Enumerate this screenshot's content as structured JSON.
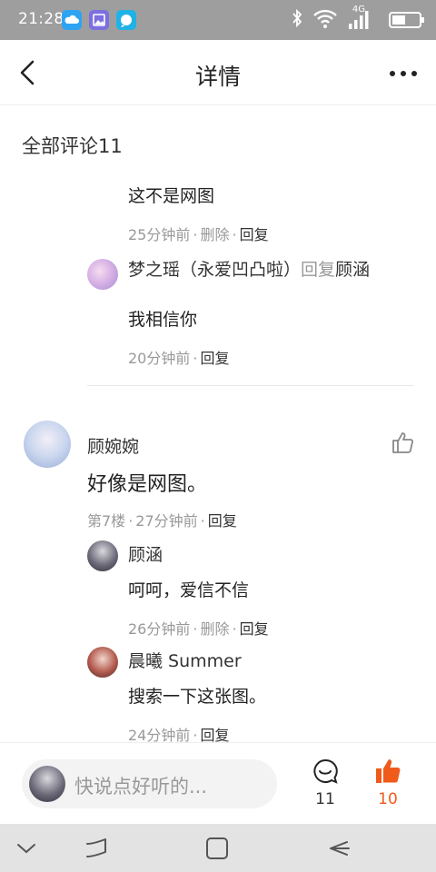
{
  "status_bar": {
    "time": "21:28",
    "network": "4G",
    "app_icons": [
      "cloud-app-icon",
      "gallery-app-icon",
      "chat-app-icon"
    ]
  },
  "header": {
    "title": "详情",
    "back_icon": "chevron-left-icon",
    "more_icon": "more-dots-icon"
  },
  "section": {
    "heading": "全部评论11"
  },
  "partial_thread": {
    "first_reply": {
      "text": "这不是网图",
      "time": "25分钟前",
      "actions": [
        "删除",
        "回复"
      ]
    },
    "second_reply": {
      "author": "梦之瑶（永爱凹凸啦）",
      "reply_word": "回复",
      "reply_to": "顾涵",
      "text": "我相信你",
      "time": "20分钟前",
      "actions": [
        "回复"
      ]
    }
  },
  "comment": {
    "author": "顾婉婉",
    "text": "好像是网图。",
    "floor": "第7楼",
    "time": "27分钟前",
    "action": "回复",
    "replies": [
      {
        "author": "顾涵",
        "text": "呵呵，爱信不信",
        "time": "26分钟前",
        "actions": [
          "删除",
          "回复"
        ]
      },
      {
        "author": "晨曦 Summer",
        "text": "搜索一下这张图。",
        "time": "24分钟前",
        "actions": [
          "回复"
        ]
      }
    ]
  },
  "bottom_bar": {
    "placeholder": "快说点好听的...",
    "comment_count": "11",
    "like_count": "10"
  },
  "colors": {
    "status_bar": "#9e9e9e",
    "accent": "#f05a1a",
    "muted_text": "#999999",
    "nav_bar": "#e3e3e3"
  }
}
